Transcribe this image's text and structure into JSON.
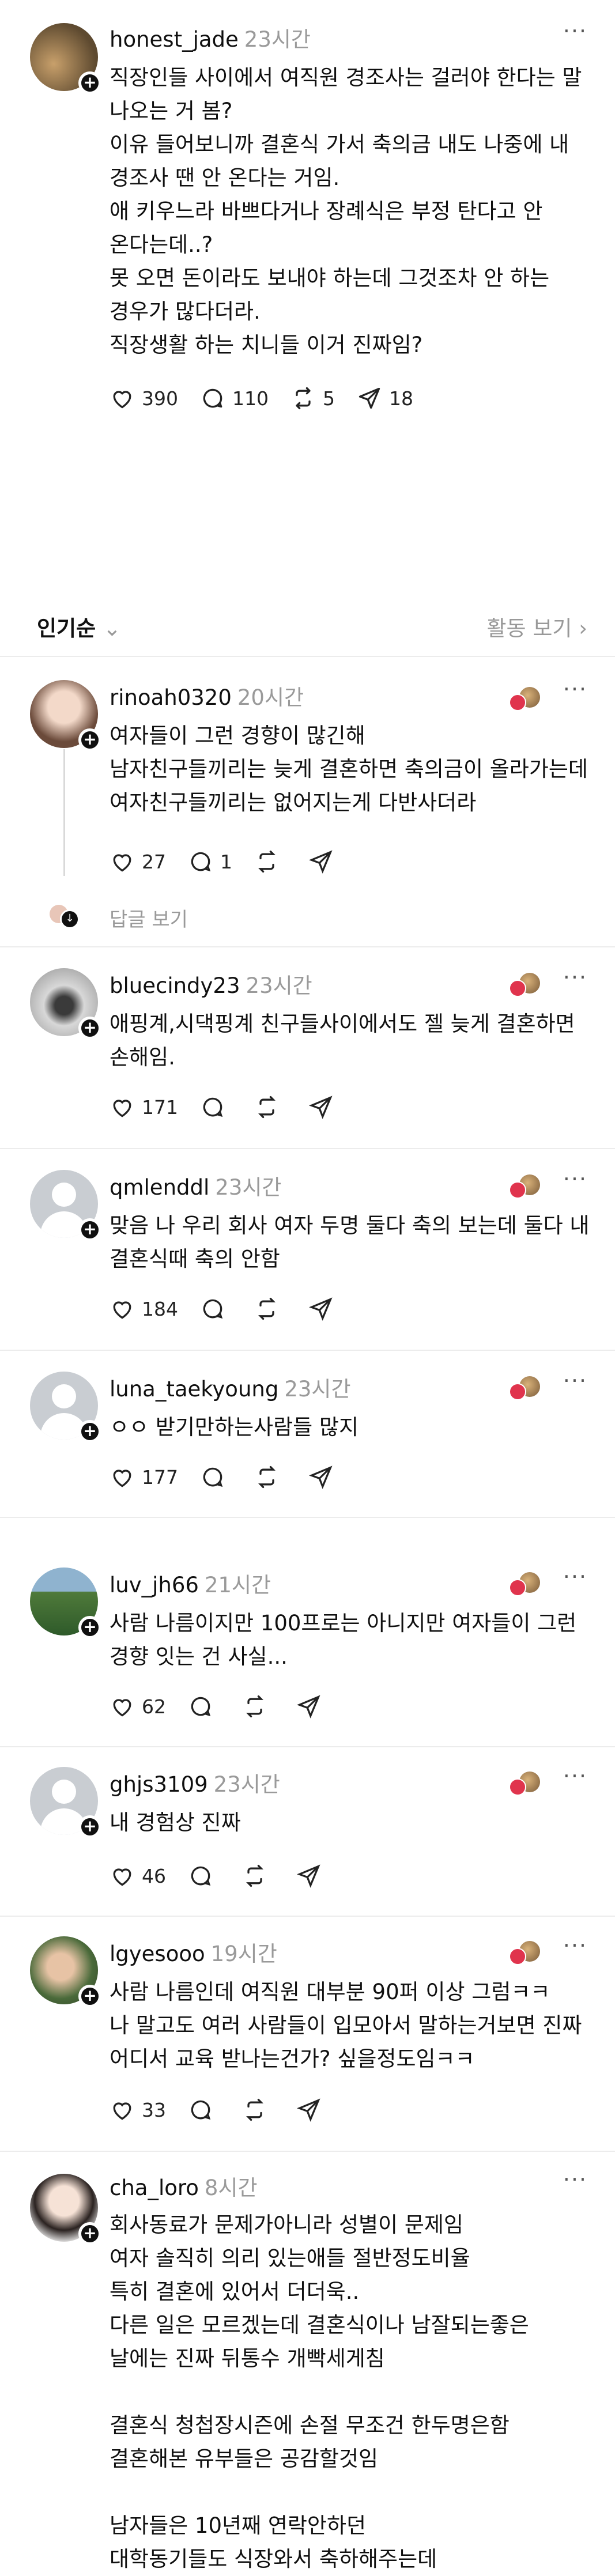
{
  "post": {
    "username": "honest_jade",
    "time": "23시간",
    "text": "직장인들 사이에서 여직원 경조사는 걸러야 한다는 말\n나오는 거 봄?\n이유 들어보니까 결혼식 가서 축의금 내도 나중에 내\n경조사 땐 안 온다는 거임.\n애 키우느라 바쁘다거나 장례식은 부정 탄다고 안\n온다는데..?\n 못 오면 돈이라도 보내야 하는데 그것조차 안 하는\n경우가 많다더라.\n직장생활 하는 치니들 이거 진짜임?",
    "likes": "390",
    "comments": "110",
    "reposts": "5",
    "shares": "18"
  },
  "sort": {
    "label": "인기순",
    "activity": "활동 보기"
  },
  "replies": [
    {
      "username": "rinoah0320",
      "time": "20시간",
      "text": "여자들이 그런 경향이 많긴해\n남자친구들끼리는 늦게 결혼하면 축의금이 올라가는데\n여자친구들끼리는 없어지는게 다반사더라",
      "likes": "27",
      "comments": "1",
      "view_replies": "답글 보기"
    },
    {
      "username": "bluecindy23",
      "time": "23시간",
      "text": "애핑계,시댁핑계 친구들사이에서도 젤 늦게 결혼하면\n손해임.",
      "likes": "171"
    },
    {
      "username": "qmlenddl",
      "time": "23시간",
      "text": "맞음 나 우리 회사 여자 두명 둘다 축의 보는데 둘다 내\n결혼식때 축의 안함",
      "likes": "184"
    },
    {
      "username": "luna_taekyoung",
      "time": "23시간",
      "text": "ㅇㅇ 받기만하는사람들 많지",
      "likes": "177"
    },
    {
      "username": "luv_jh66",
      "time": "21시간",
      "text": "사람 나름이지만 100프로는 아니지만 여자들이 그런\n경향 잇는 건 사실...",
      "likes": "62"
    },
    {
      "username": "ghjs3109",
      "time": "23시간",
      "text": "내 경험상 진짜",
      "likes": "46"
    },
    {
      "username": "lgyesooo",
      "time": "19시간",
      "text": "사람 나름인데 여직원 대부분 90퍼 이상 그럼ㅋㅋ\n나 말고도 여러 사람들이 입모아서 말하는거보면 진짜\n어디서 교육 받나는건가? 싶을정도임ㅋㅋ",
      "likes": "33"
    },
    {
      "username": "cha_loro",
      "time": "8시간",
      "text": "회사동료가 문제가아니라 성별이 문제임\n여자 솔직히 의리 있는애들 절반정도비율\n특히 결혼에 있어서 더더욱..\n다른 일은 모르겠는데 결혼식이나 남잘되는좋은\n날에는 진짜 뒤통수 개빡세게침\n\n결혼식 청첩장시즌에 손절 무조건 한두명은함\n결혼해본 유부들은 공감할것임\n\n남자들은 10년째 연락안하던\n대학동기들도 식장와서 축하해주는데"
    }
  ]
}
